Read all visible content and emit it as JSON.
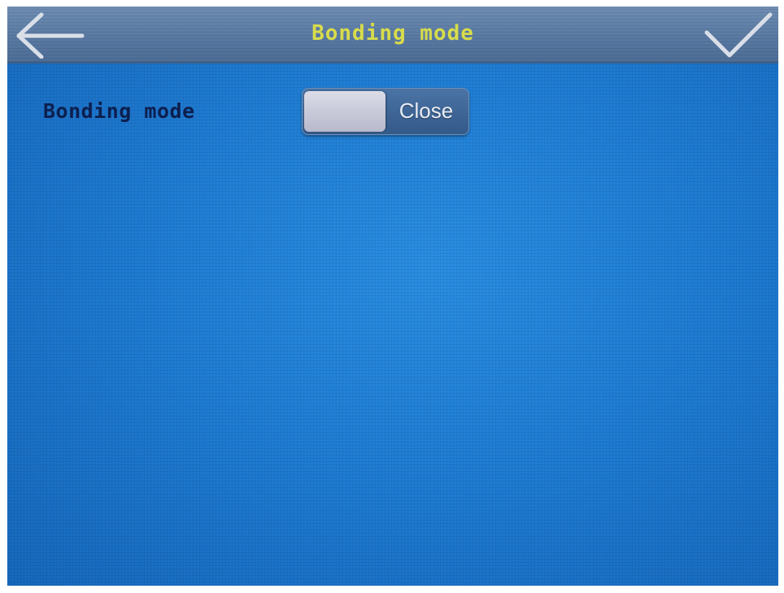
{
  "header": {
    "title": "Bonding mode",
    "back_icon": "arrow-left-icon",
    "confirm_icon": "checkmark-icon"
  },
  "settings": {
    "bonding_mode": {
      "label": "Bonding mode",
      "toggle_state": "Close"
    }
  },
  "colors": {
    "title_text": "#d8dc4a",
    "label_text": "#0d1f4f",
    "background": "#1f7dd4",
    "title_bar": "#5a7aa3"
  }
}
